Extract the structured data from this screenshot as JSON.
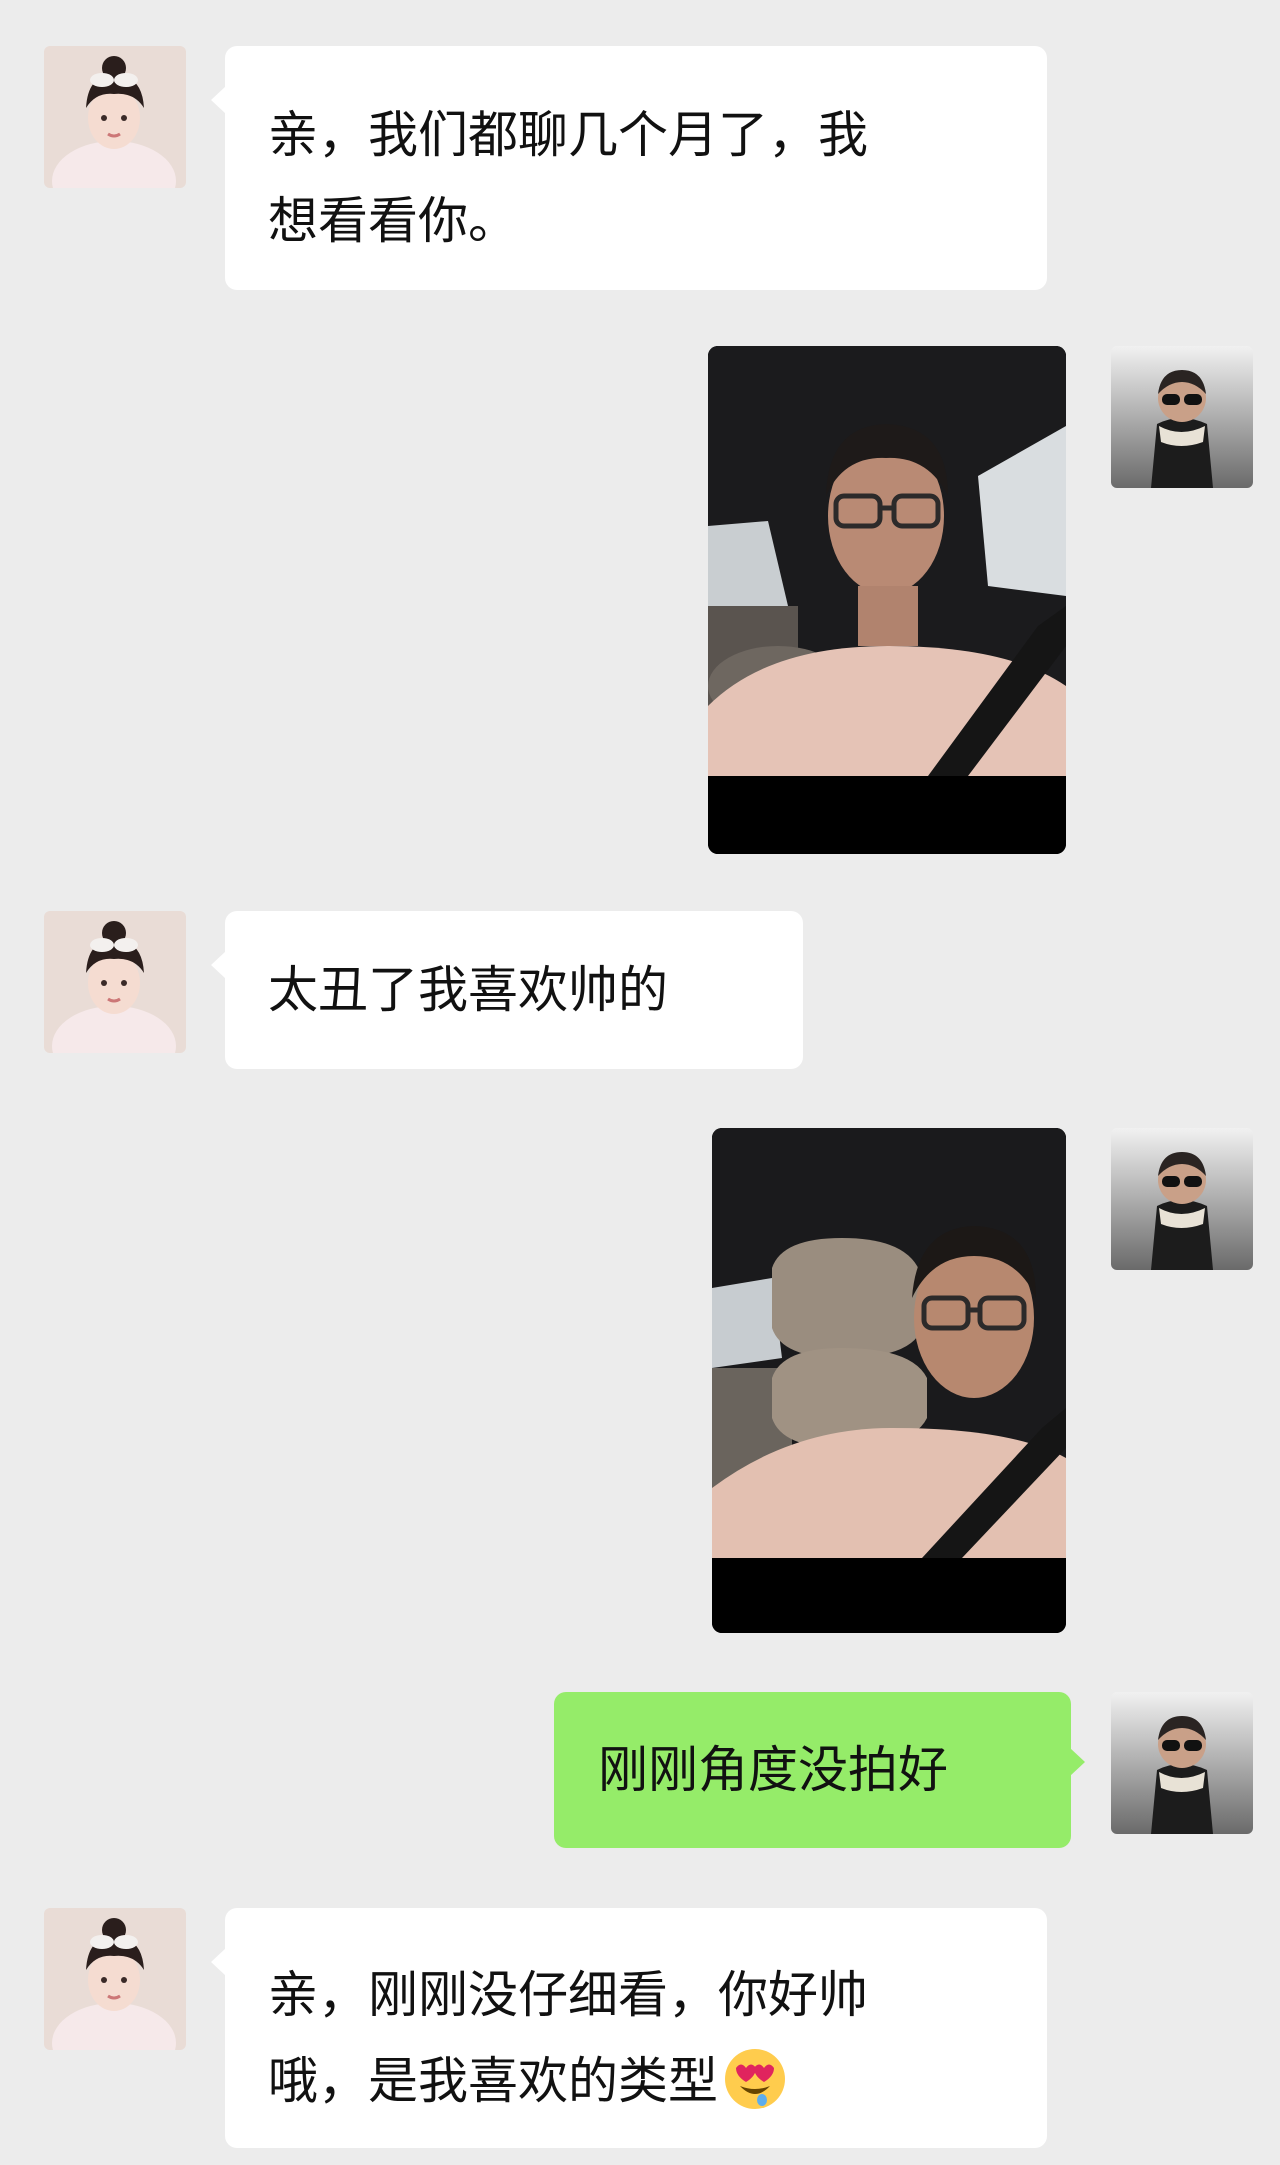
{
  "chat": {
    "messages": [
      {
        "sender": "contact",
        "type": "text",
        "text_line1": "亲，我们都聊几个月了，我",
        "text_line2": "想看看你。"
      },
      {
        "sender": "me",
        "type": "photo",
        "description_icon": "selfie-in-car-photo"
      },
      {
        "sender": "contact",
        "type": "text",
        "text": "太丑了我喜欢帅的"
      },
      {
        "sender": "me",
        "type": "photo",
        "description_icon": "selfie-with-headrest-photo"
      },
      {
        "sender": "me",
        "type": "text",
        "text": "刚刚角度没拍好"
      },
      {
        "sender": "contact",
        "type": "text",
        "text_line1": "亲，刚刚没仔细看，你好帅",
        "text_line2": "哦，是我喜欢的类型",
        "emoji": "heart-eyes-emoji"
      }
    ]
  },
  "colors": {
    "background": "#ececec",
    "incoming_bubble": "#ffffff",
    "outgoing_bubble": "#95ec69"
  }
}
